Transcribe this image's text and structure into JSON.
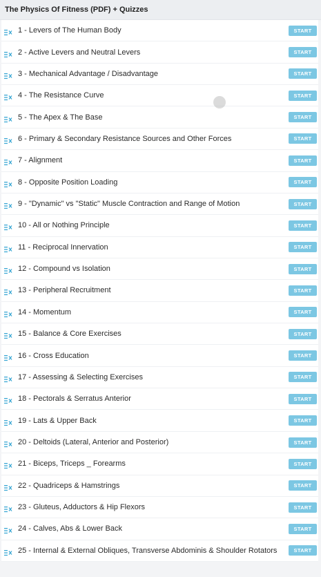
{
  "section": {
    "title": "The Physics Of Fitness (PDF) + Quizzes",
    "start_label": "START",
    "colors": {
      "start_bg": "#7cc7e3",
      "icon": "#3aa7d4"
    },
    "icon_name": "lesson-list-icon"
  },
  "lessons": [
    {
      "title": "1 - Levers of The Human Body"
    },
    {
      "title": "2 - Active Levers and Neutral Levers"
    },
    {
      "title": "3 - Mechanical Advantage / Disadvantage"
    },
    {
      "title": "4 - The Resistance Curve"
    },
    {
      "title": "5 - The Apex & The Base"
    },
    {
      "title": "6 - Primary & Secondary Resistance Sources and Other Forces"
    },
    {
      "title": "7 - Alignment"
    },
    {
      "title": "8 - Opposite Position Loading"
    },
    {
      "title": "9 - \"Dynamic\" vs \"Static\" Muscle Contraction and Range of Motion"
    },
    {
      "title": "10 - All or Nothing Principle"
    },
    {
      "title": "11 - Reciprocal Innervation"
    },
    {
      "title": "12 - Compound vs Isolation"
    },
    {
      "title": "13 - Peripheral Recruitment"
    },
    {
      "title": "14 - Momentum"
    },
    {
      "title": "15 - Balance & Core Exercises"
    },
    {
      "title": "16 - Cross Education"
    },
    {
      "title": "17 - Assessing & Selecting Exercises"
    },
    {
      "title": "18 - Pectorals & Serratus Anterior"
    },
    {
      "title": "19 - Lats & Upper Back"
    },
    {
      "title": "20 - Deltoids (Lateral, Anterior and Posterior)"
    },
    {
      "title": "21 - Biceps, Triceps _ Forearms"
    },
    {
      "title": "22 - Quadriceps & Hamstrings"
    },
    {
      "title": "23 - Gluteus, Adductors & Hip Flexors"
    },
    {
      "title": "24 - Calves, Abs & Lower Back"
    },
    {
      "title": "25 - Internal & External Obliques, Transverse Abdominis & Shoulder Rotators"
    }
  ]
}
